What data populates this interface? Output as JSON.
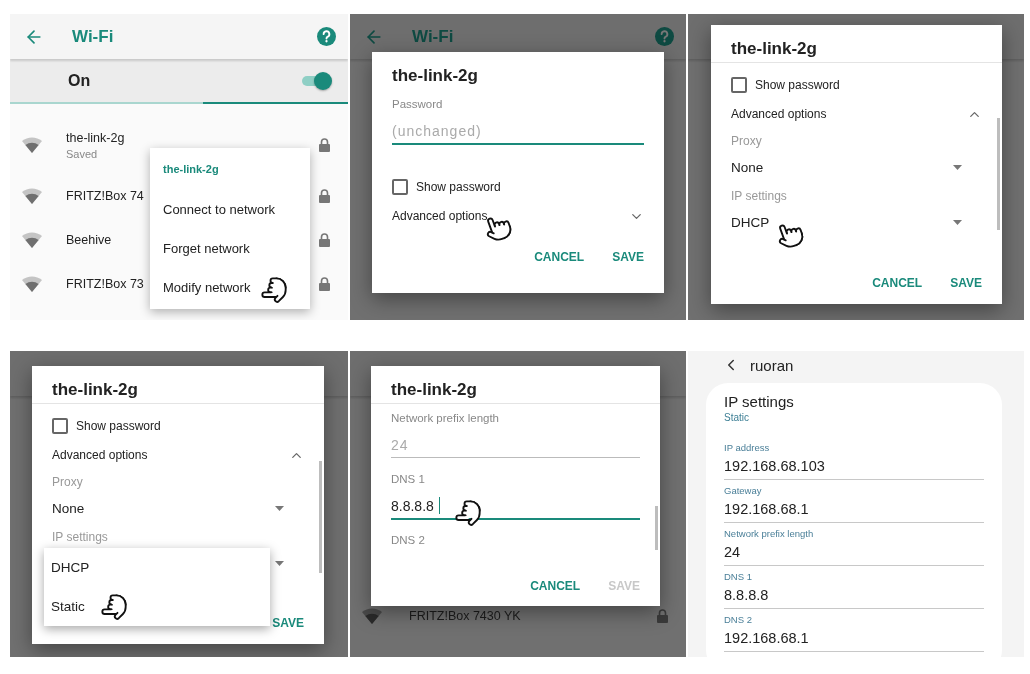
{
  "panels": [
    {
      "kind": "wifi_list",
      "title": "Wi-Fi",
      "toggle": {
        "label": "On",
        "on": true
      },
      "scanning": true,
      "networks": [
        {
          "name": "the-link-2g",
          "status": "Saved"
        },
        {
          "name": "FRITZ!Box 74"
        },
        {
          "name": "Beehive"
        },
        {
          "name": "FRITZ!Box 73"
        }
      ],
      "menu": {
        "title": "the-link-2g",
        "items": [
          "Connect to network",
          "Forget network",
          "Modify network"
        ]
      }
    },
    {
      "kind": "dialog",
      "background": {
        "title": "Wi-Fi"
      },
      "dialog": {
        "title": "the-link-2g",
        "scrolling": false,
        "rows": [
          {
            "kind": "text_field",
            "label": "Password",
            "placeholder": "(unchanged)",
            "focused": true
          },
          {
            "kind": "checkbox",
            "label": "Show password",
            "checked": false
          },
          {
            "kind": "expander",
            "label": "Advanced options",
            "expanded": false
          }
        ],
        "buttons": [
          {
            "label": "CANCEL",
            "disabled": false
          },
          {
            "label": "SAVE",
            "disabled": false
          }
        ]
      }
    },
    {
      "kind": "dialog",
      "dialog": {
        "title": "the-link-2g",
        "scrolling": true,
        "rows": [
          {
            "kind": "checkbox",
            "label": "Show password",
            "checked": false
          },
          {
            "kind": "expander",
            "label": "Advanced options",
            "expanded": true
          },
          {
            "kind": "dropdown",
            "label": "Proxy",
            "value": "None"
          },
          {
            "kind": "dropdown",
            "label": "IP settings",
            "value": "DHCP"
          }
        ],
        "buttons": [
          {
            "label": "CANCEL",
            "disabled": false
          },
          {
            "label": "SAVE",
            "disabled": false
          }
        ]
      }
    },
    {
      "kind": "dialog",
      "dialog": {
        "title": "the-link-2g",
        "scrolling": true,
        "rows": [
          {
            "kind": "checkbox",
            "label": "Show password",
            "checked": false
          },
          {
            "kind": "expander",
            "label": "Advanced options",
            "expanded": true
          },
          {
            "kind": "dropdown",
            "label": "Proxy",
            "value": "None"
          },
          {
            "kind": "dropdown",
            "label": "IP settings",
            "options": [
              "DHCP",
              "Static"
            ]
          }
        ],
        "buttons": [
          {
            "label": "SAVE",
            "disabled": false
          }
        ]
      }
    },
    {
      "kind": "dialog",
      "background": {
        "network": "FRITZ!Box 7430 YK"
      },
      "dialog": {
        "title": "the-link-2g",
        "scrolling": true,
        "rows": [
          {
            "kind": "text_field",
            "label": "Network prefix length",
            "placeholder": "24",
            "focused": false
          },
          {
            "kind": "text_field",
            "label": "DNS 1",
            "value": "8.8.8.8",
            "focused": true
          },
          {
            "kind": "text_field",
            "label": "DNS 2"
          }
        ],
        "buttons": [
          {
            "label": "CANCEL",
            "disabled": false
          },
          {
            "label": "SAVE",
            "disabled": true
          }
        ]
      }
    },
    {
      "kind": "settings",
      "back_title": "ruoran",
      "section": {
        "title": "IP settings",
        "subtitle": "Static"
      },
      "fields": [
        {
          "label": "IP address",
          "value": "192.168.68.103"
        },
        {
          "label": "Gateway",
          "value": "192.168.68.1"
        },
        {
          "label": "Network prefix length",
          "value": "24"
        },
        {
          "label": "DNS 1",
          "value": "8.8.8.8"
        },
        {
          "label": "DNS 2",
          "value": "192.168.68.1"
        }
      ]
    }
  ]
}
